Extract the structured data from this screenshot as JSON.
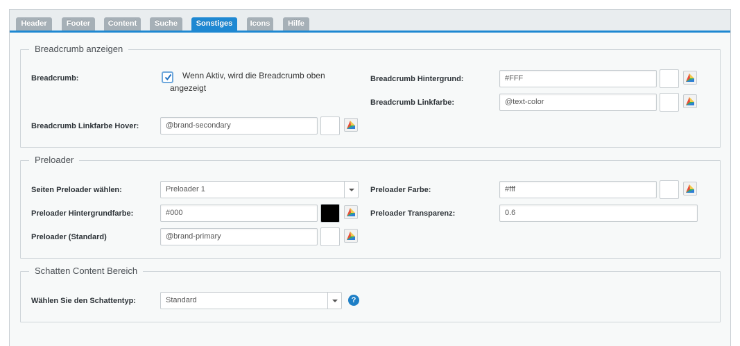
{
  "tabs": [
    {
      "label": "Header",
      "active": false
    },
    {
      "label": "Footer",
      "active": false
    },
    {
      "label": "Content",
      "active": false
    },
    {
      "label": "Suche",
      "active": false
    },
    {
      "label": "Sonstiges",
      "active": true
    },
    {
      "label": "Icons",
      "active": false
    },
    {
      "label": "Hilfe",
      "active": false
    }
  ],
  "breadcrumb": {
    "legend": "Breadcrumb anzeigen",
    "enable_label": "Breadcrumb:",
    "enable_checked": true,
    "enable_text": "Wenn Aktiv, wird die Breadcrumb oben angezeigt",
    "hover_label": "Breadcrumb Linkfarbe Hover:",
    "hover_value": "@brand-secondary",
    "bg_label": "Breadcrumb Hintergrund:",
    "bg_value": "#FFF",
    "link_label": "Breadcrumb Linkfarbe:",
    "link_value": "@text-color"
  },
  "preloader": {
    "legend": "Preloader",
    "select_label": "Seiten Preloader wählen:",
    "select_value": "Preloader 1",
    "bgcolor_label": "Preloader Hintergrundfarbe:",
    "bgcolor_value": "#000",
    "standard_label": "Preloader (Standard)",
    "standard_value": "@brand-primary",
    "color_label": "Preloader Farbe:",
    "color_value": "#fff",
    "opacity_label": "Preloader Transparenz:",
    "opacity_value": "0.6"
  },
  "shadow": {
    "legend": "Schatten Content Bereich",
    "type_label": "Wählen Sie den Schattentyp:",
    "type_value": "Standard",
    "help_glyph": "?"
  },
  "colors": {
    "accent": "#1e88d2",
    "tab_inactive": "#a6b0b7"
  },
  "icons": {
    "color_picker": "color-picker-icon",
    "dropdown": "chevron-down-icon",
    "help": "help-icon",
    "check": "check-icon"
  }
}
